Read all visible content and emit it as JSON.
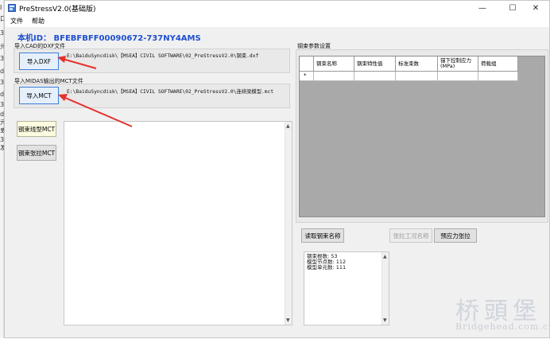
{
  "window": {
    "title": "PreStressV2.0(基础版)"
  },
  "controls": {
    "minimize": "—",
    "maximize": "☐",
    "close": "✕"
  },
  "menu": {
    "file": "文件",
    "help": "帮助"
  },
  "machine_id": "本机ID： BFEBFBFF00090672-737NY4AMS",
  "cad_group": {
    "label": "导入CAD的DXF文件",
    "button": "导入DXF",
    "path": "E:\\BaiduSyncdisk\\【MSEA】CIVIL SOFTWARE\\02_PreStressV2.0\\钢束.dxf"
  },
  "midas_group": {
    "label": "导入MIDAS输出的MCT文件",
    "button": "导入MCT",
    "path": "E:\\BaiduSyncdisk\\【MSEA】CIVIL SOFTWARE\\02_PreStressV2.0\\连续梁模型.mct"
  },
  "side_buttons": {
    "shape_mct": "钢束线型MCT",
    "tension_mct": "钢束张拉MCT"
  },
  "params": {
    "label": "钢束参数设置",
    "columns": [
      "钢束名称",
      "钢束特性值",
      "标准束数",
      "锚下控制应力(MPa)",
      "荷载组"
    ],
    "new_row_marker": "*"
  },
  "actions": {
    "read_names": "读取钢束名称",
    "tension_case_name": "张拉工况名称",
    "prestress_tension": "预应力张拉"
  },
  "info": {
    "lines": [
      "钢束根数: 53",
      "模型节点数: 112",
      "模型单元数: 111"
    ]
  },
  "scroll": {
    "up": "▲",
    "down": "▼"
  },
  "desktop_fragment": [
    "I",
    "口",
    "3",
    "元",
    "3",
    "d",
    "3",
    "d",
    "3",
    "d",
    "元",
    "更",
    "3",
    "发"
  ],
  "watermark": {
    "cn": "桥頭堡",
    "en": "Bridgehead.com.cn"
  }
}
